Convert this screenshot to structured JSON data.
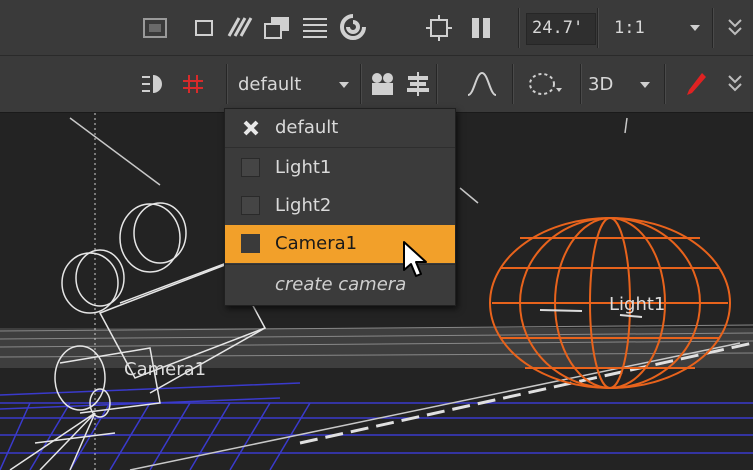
{
  "toolbar_top": {
    "zoom_value": "24.7'",
    "ratio_value": "1:1",
    "icons": [
      "mask-icon",
      "roi-icon",
      "wipe-icon",
      "overlay-icon",
      "lines-icon",
      "sync-icon",
      "crosshair-icon",
      "pause-icon",
      "chevron-double-icon"
    ]
  },
  "toolbar_second": {
    "camera_select": "default",
    "view_mode": "3D",
    "icons": [
      "light-icon",
      "grid-icon",
      "camera-select-icon",
      "align-icon",
      "curve-icon",
      "selection-icon",
      "pen-icon",
      "chevron-double-icon"
    ]
  },
  "menu": {
    "items": [
      {
        "label": "default",
        "checked": true
      },
      {
        "label": "Light1",
        "checked": false
      },
      {
        "label": "Light2",
        "checked": false
      },
      {
        "label": "Camera1",
        "checked": false,
        "highlighted": true
      },
      {
        "label": "create camera",
        "action": true
      }
    ]
  },
  "viewport": {
    "labels": {
      "camera": "Camera1",
      "light": "Light1"
    },
    "colors": {
      "light_wire": "#e8631c",
      "grid": "#3a3acc",
      "camera_wire": "#e6e6e6",
      "highlight": "#f2a02a"
    }
  }
}
